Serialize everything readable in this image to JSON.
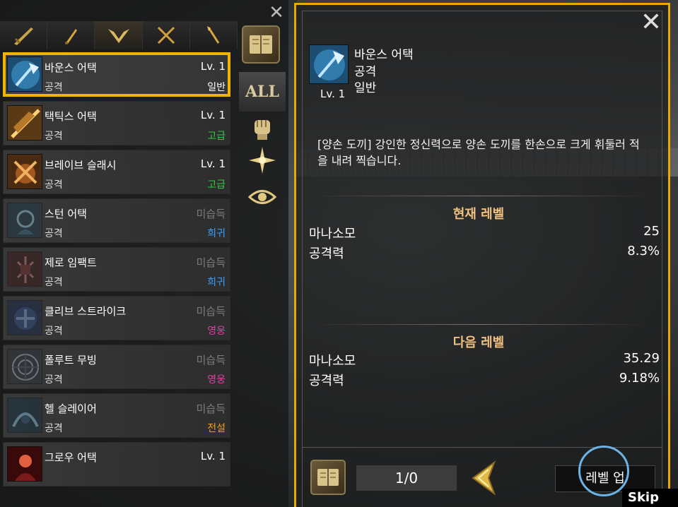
{
  "skill_list": {
    "rows": [
      {
        "name": "바운스 어택",
        "type": "공격",
        "level": "Lv. 1",
        "grade": "일반",
        "grade_color": "#ffffff",
        "icon": "axe-strike-icon",
        "icon_colors": [
          "#3b8ec7",
          "#bfe6ff"
        ],
        "selected": true,
        "locked": false
      },
      {
        "name": "택틱스 어택",
        "type": "공격",
        "level": "Lv. 1",
        "grade": "고급",
        "grade_color": "#2ecc40",
        "icon": "axe-slash-icon",
        "icon_colors": [
          "#b8782a",
          "#ffd27a"
        ],
        "selected": false,
        "locked": false
      },
      {
        "name": "브레이브 슬래시",
        "type": "공격",
        "level": "Lv. 1",
        "grade": "고급",
        "grade_color": "#2ecc40",
        "icon": "brave-slash-icon",
        "icon_colors": [
          "#a0561e",
          "#f0b060"
        ],
        "selected": false,
        "locked": false
      },
      {
        "name": "스턴 어택",
        "type": "공격",
        "level": "미습득",
        "grade": "희귀",
        "grade_color": "#3aa0ff",
        "icon": "stun-head-icon",
        "icon_colors": [
          "#3a6e8a",
          "#a0d8f0"
        ],
        "selected": false,
        "locked": true
      },
      {
        "name": "제로 임팩트",
        "type": "공격",
        "level": "미습득",
        "grade": "희귀",
        "grade_color": "#3aa0ff",
        "icon": "zero-impact-icon",
        "icon_colors": [
          "#7a2a2a",
          "#d08080"
        ],
        "selected": false,
        "locked": true
      },
      {
        "name": "클리브 스트라이크",
        "type": "공격",
        "level": "미습득",
        "grade": "영웅",
        "grade_color": "#e040a0",
        "icon": "cleave-icon",
        "icon_colors": [
          "#2a4a8a",
          "#80a8e0"
        ],
        "selected": false,
        "locked": true
      },
      {
        "name": "폴루트 무빙",
        "type": "공격",
        "level": "미습득",
        "grade": "영웅",
        "grade_color": "#e040a0",
        "icon": "web-move-icon",
        "icon_colors": [
          "#4a5a6a",
          "#b0c0d0"
        ],
        "selected": false,
        "locked": true
      },
      {
        "name": "헬 슬레이어",
        "type": "공격",
        "level": "미습득",
        "grade": "전설",
        "grade_color": "#f0a020",
        "icon": "hell-slayer-icon",
        "icon_colors": [
          "#2a5a7a",
          "#90c8e8"
        ],
        "selected": false,
        "locked": true
      },
      {
        "name": "그로우 어택",
        "type": "",
        "level": "Lv. 1",
        "grade": "",
        "grade_color": "#ffffff",
        "icon": "grow-attack-icon",
        "icon_colors": [
          "#7a1a1a",
          "#e06040"
        ],
        "selected": false,
        "locked": false
      }
    ]
  },
  "side_filters": {
    "all_label": "ALL"
  },
  "detail": {
    "name": "바운스 어택",
    "type": "공격",
    "grade": "일반",
    "level": "Lv. 1",
    "description": "[양손 도끼] 강인한 정신력으로 양손 도끼를 한손으로 크게 휘둘러 적을 내려 찍습니다.",
    "current": {
      "header": "현재 레벨",
      "stats": [
        {
          "label": "마나소모",
          "value": "25"
        },
        {
          "label": "공격력",
          "value": "8.3%"
        }
      ]
    },
    "next": {
      "header": "다음 레벨",
      "stats": [
        {
          "label": "마나소모",
          "value": "35.29"
        },
        {
          "label": "공격력",
          "value": "9.18%"
        }
      ]
    },
    "page": "1/0",
    "levelup_label": "레벨 업"
  },
  "skip_label": "Skip",
  "colors": {
    "accent_gold": "#e8a800",
    "header_text": "#f0c080",
    "hint_circle": "#6cb4e6"
  }
}
